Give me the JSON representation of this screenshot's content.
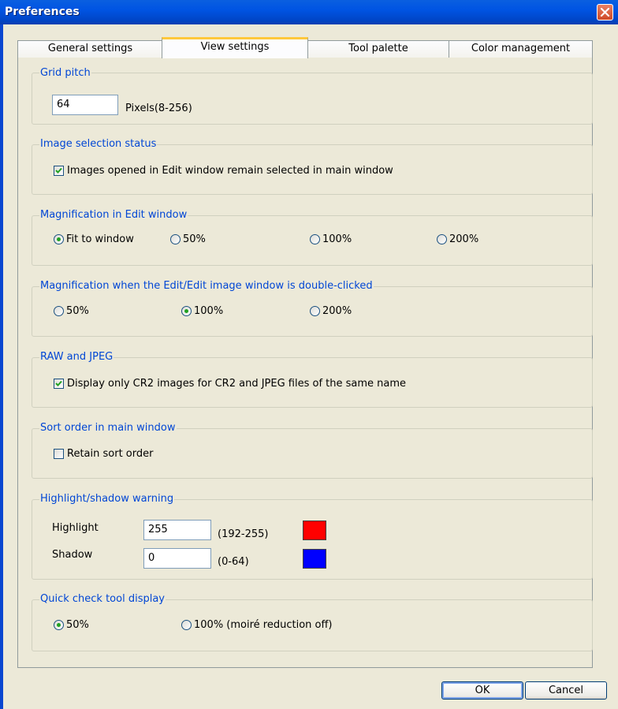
{
  "window": {
    "title": "Preferences"
  },
  "tabs": [
    {
      "label": "General settings",
      "active": false
    },
    {
      "label": "View settings",
      "active": true
    },
    {
      "label": "Tool palette",
      "active": false
    },
    {
      "label": "Color management",
      "active": false
    }
  ],
  "grid_pitch": {
    "legend": "Grid pitch",
    "value": "64",
    "unit_label": "Pixels(8-256)"
  },
  "image_selection": {
    "legend": "Image selection status",
    "checkbox_label": "Images opened in Edit window remain selected in main window",
    "checked": true
  },
  "magnification_edit": {
    "legend": "Magnification in Edit window",
    "options": [
      "Fit to window",
      "50%",
      "100%",
      "200%"
    ],
    "selected": "Fit to window"
  },
  "magnification_double_click": {
    "legend": "Magnification when the Edit/Edit image window is double-clicked",
    "options": [
      "50%",
      "100%",
      "200%"
    ],
    "selected": "100%"
  },
  "raw_jpeg": {
    "legend": "RAW and JPEG",
    "checkbox_label": "Display only CR2 images for CR2 and JPEG files of the same name",
    "checked": true
  },
  "sort_order": {
    "legend": "Sort order in main window",
    "checkbox_label": "Retain sort order",
    "checked": false
  },
  "warning": {
    "legend": "Highlight/shadow warning",
    "highlight_label": "Highlight",
    "highlight_value": "255",
    "highlight_range": "(192-255)",
    "highlight_color": "#ff0000",
    "shadow_label": "Shadow",
    "shadow_value": "0",
    "shadow_range": "(0-64)",
    "shadow_color": "#0000ff"
  },
  "quick_check": {
    "legend": "Quick check tool display",
    "options": [
      "50%",
      "100% (moiré reduction off)"
    ],
    "selected": "50%"
  },
  "footer": {
    "ok_label": "OK",
    "cancel_label": "Cancel"
  },
  "icons": {
    "close": "close-icon",
    "check": "check-icon"
  }
}
